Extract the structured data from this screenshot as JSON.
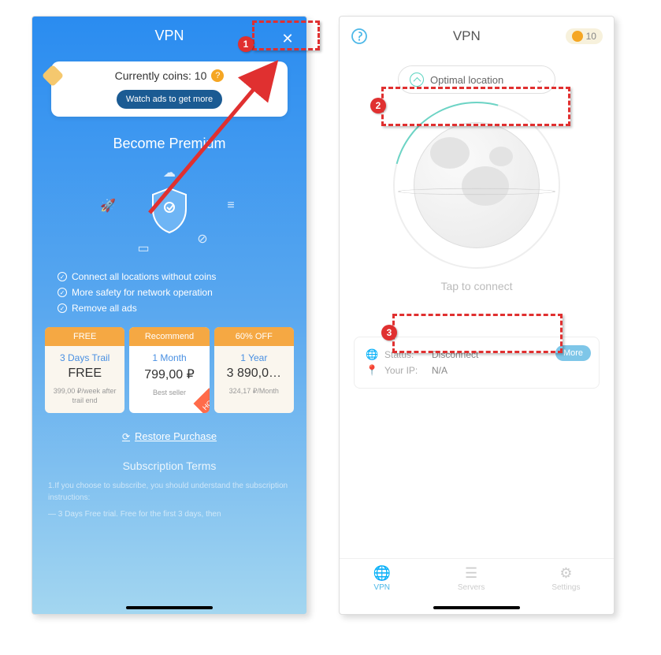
{
  "left": {
    "title": "VPN",
    "coins_label": "Currently coins: 10",
    "watch_ads": "Watch ads to get more",
    "premium_title": "Become Premium",
    "features": [
      "Connect all locations without coins",
      "More safety for network operation",
      "Remove all ads"
    ],
    "plans": [
      {
        "badge": "FREE",
        "period": "3 Days Trail",
        "price": "FREE",
        "sub": "399,00 ₽/week after trail end"
      },
      {
        "badge": "Recommend",
        "period": "1 Month",
        "price": "799,00 ₽",
        "sub": "Best seller",
        "hot": "HOT"
      },
      {
        "badge": "60% OFF",
        "period": "1 Year",
        "price": "3 890,0…",
        "sub": "324,17 ₽/Month"
      }
    ],
    "restore": "Restore Purchase",
    "terms_title": "Subscription Terms",
    "terms_1": "1.If you choose to subscribe, you should understand the subscription instructions:",
    "terms_2": "— 3 Days Free trial. Free for the first 3 days, then"
  },
  "right": {
    "title": "VPN",
    "coins": "10",
    "location": "Optimal location",
    "tap": "Tap to connect",
    "status_label": "Status:",
    "status_value": "Disconnect",
    "ip_label": "Your IP:",
    "ip_value": "N/A",
    "more": "More",
    "tabs": {
      "vpn": "VPN",
      "servers": "Servers",
      "settings": "Settings"
    }
  },
  "callouts": {
    "n1": "1",
    "n2": "2",
    "n3": "3"
  }
}
